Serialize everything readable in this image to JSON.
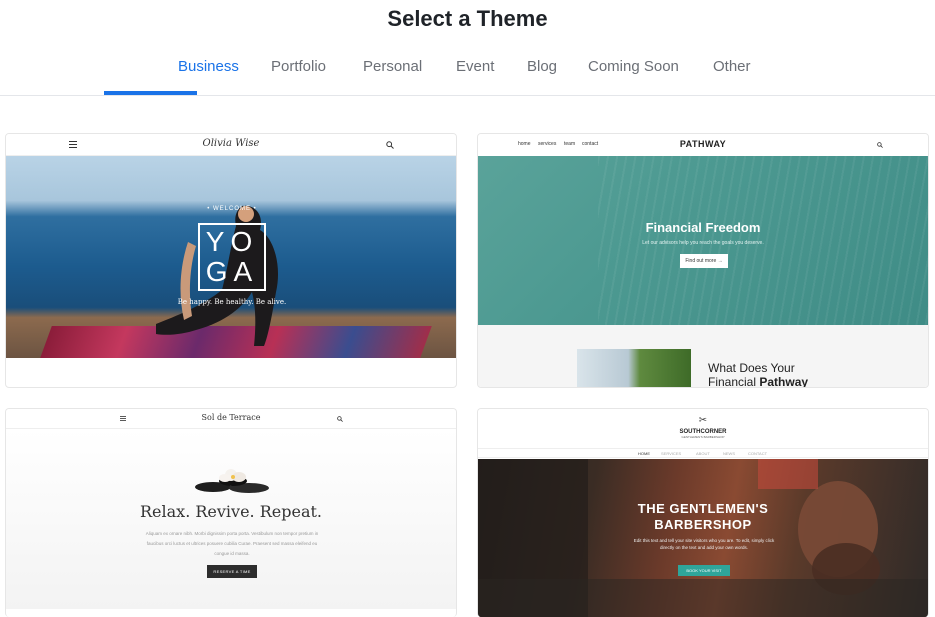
{
  "page": {
    "title": "Select a Theme"
  },
  "tabs": [
    {
      "label": "Business",
      "active": true
    },
    {
      "label": "Portfolio"
    },
    {
      "label": "Personal"
    },
    {
      "label": "Event"
    },
    {
      "label": "Blog"
    },
    {
      "label": "Coming Soon"
    },
    {
      "label": "Other"
    }
  ],
  "colors": {
    "accent": "#1a73e8",
    "muted": "#6b6f76"
  },
  "themes": {
    "yoga": {
      "brand": "Olivia Wise",
      "kicker": "• WELCOME •",
      "hero_line1": "YO",
      "hero_line2": "GA",
      "tagline": "Be happy. Be healthy. Be alive."
    },
    "pathway": {
      "nav": [
        "home",
        "services",
        "team",
        "contact"
      ],
      "logo": "PATHWAY",
      "hero_title": "Financial Freedom",
      "hero_sub": "Let our advisors help you reach the goals you deserve.",
      "cta": "Find out more  →",
      "section_title_line1": "What Does Your",
      "section_title_line2_plain": "Financial ",
      "section_title_line2_bold": "Pathway"
    },
    "terrace": {
      "brand": "Sol de Terrace",
      "headline": "Relax. Revive. Repeat.",
      "paragraph": "Aliquam ex ornare nibh. Morbi dignissim porta porta. Vestibulum non tempor pretium in faucibus orci luctus et ultrices posuere cubilia Curae. Praesent sed massa eleifend eu congue id massa.",
      "cta": "RESERVE A TIME"
    },
    "southcorner": {
      "logo": "SOUTHCORNER",
      "logo_sub": "GENTLEMEN'S BARBERSHOP",
      "menu": [
        "HOME",
        "SERVICES",
        "ABOUT",
        "NEWS",
        "CONTACT"
      ],
      "hero_line1": "THE GENTLEMEN'S",
      "hero_line2": "BARBERSHOP",
      "hero_sub": "Edit this text and tell your site visitors who you are. To edit, simply click directly on the text and add your own words.",
      "cta": "BOOK YOUR VISIT"
    }
  }
}
